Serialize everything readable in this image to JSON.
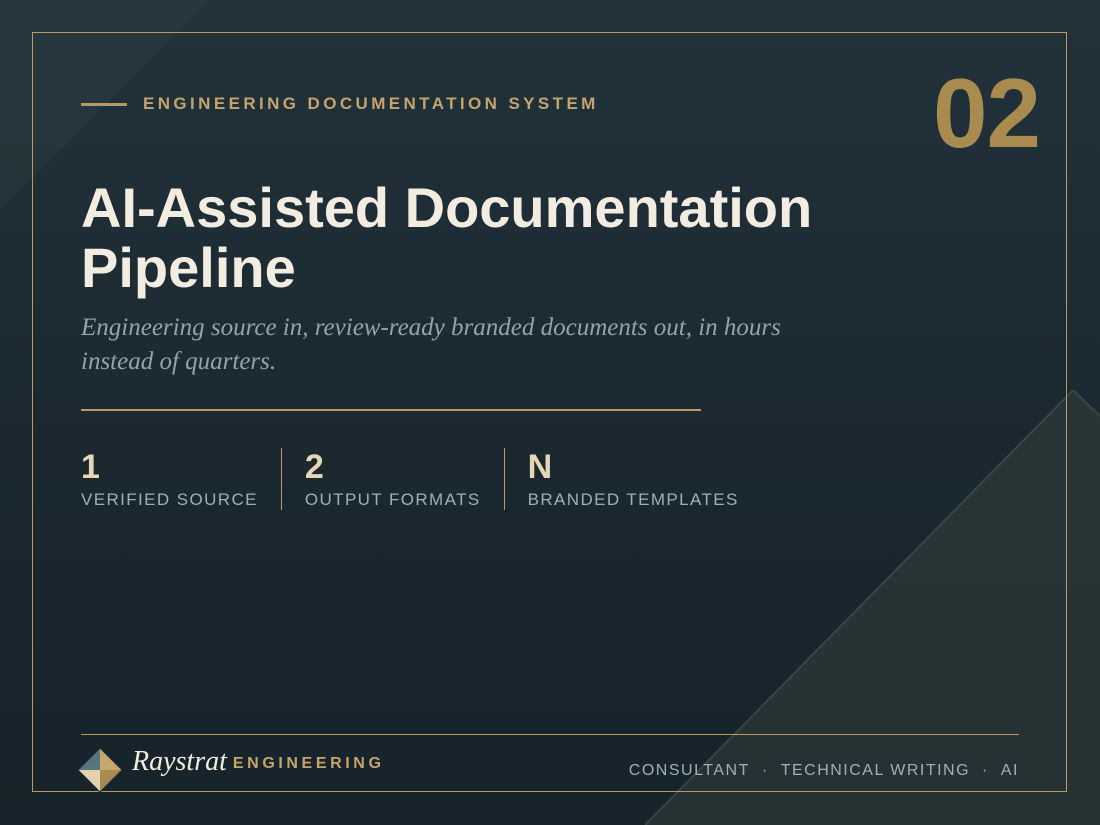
{
  "header": {
    "eyebrow": "ENGINEERING DOCUMENTATION SYSTEM",
    "slide_number": "02"
  },
  "main": {
    "title": "AI-Assisted Documentation Pipeline",
    "subtitle": "Engineering source in, review-ready branded documents out, in hours instead of quarters.",
    "stats": [
      {
        "value": "1",
        "label": "VERIFIED SOURCE"
      },
      {
        "value": "2",
        "label": "OUTPUT FORMATS"
      },
      {
        "value": "N",
        "label": "BRANDED TEMPLATES"
      }
    ]
  },
  "footer": {
    "brand_name": "Raystrat",
    "brand_sub": "ENGINEERING",
    "logo_icon": "diamond-logo-icon",
    "tags": [
      "CONSULTANT",
      "TECHNICAL WRITING",
      "AI"
    ],
    "separator": "·"
  },
  "colors": {
    "background": "#1c2a33",
    "accent_gold": "#b99a5f",
    "title_text": "#f3ece0",
    "muted_text": "#9fb0b4",
    "subtitle_text": "#8ea6aa"
  }
}
